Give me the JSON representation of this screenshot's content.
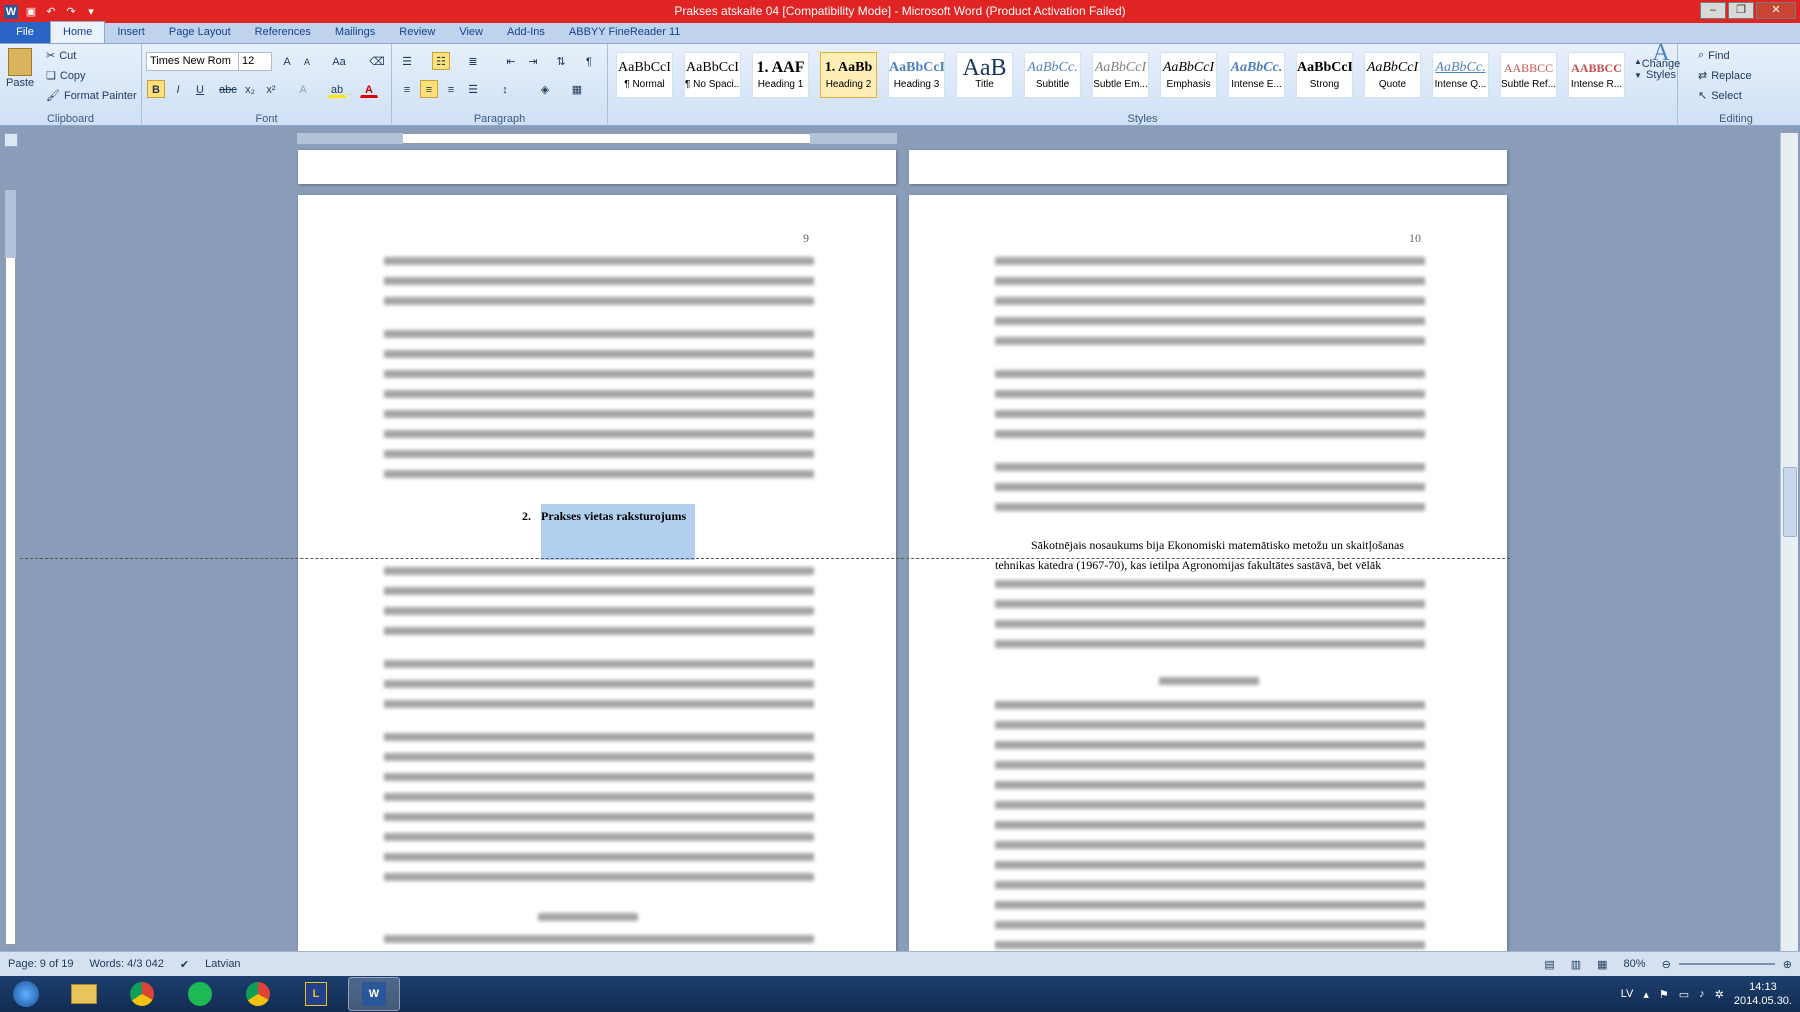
{
  "window": {
    "title": "Prakses atskaite 04 [Compatibility Mode] - Microsoft Word (Product Activation Failed)",
    "app_icon": "word-icon",
    "quick_access": [
      "save-icon",
      "undo-icon",
      "redo-icon",
      "customize-icon"
    ],
    "controls": [
      "minimize-icon",
      "restore-icon",
      "close-icon"
    ],
    "accent": "#e02424"
  },
  "tabs": [
    {
      "label": "File"
    },
    {
      "label": "Home"
    },
    {
      "label": "Insert"
    },
    {
      "label": "Page Layout"
    },
    {
      "label": "References"
    },
    {
      "label": "Mailings"
    },
    {
      "label": "Review"
    },
    {
      "label": "View"
    },
    {
      "label": "Add-Ins"
    },
    {
      "label": "ABBYY FineReader 11"
    }
  ],
  "ribbon": {
    "clipboard": {
      "label": "Clipboard",
      "paste": "Paste",
      "cut": "Cut",
      "copy": "Copy",
      "format_painter": "Format Painter"
    },
    "font": {
      "label": "Font",
      "family": "Times New Rom",
      "size": "12"
    },
    "paragraph": {
      "label": "Paragraph"
    },
    "styles": {
      "label": "Styles",
      "items": [
        {
          "preview": "AaBbCcI",
          "name": "¶ Normal"
        },
        {
          "preview": "AaBbCcI",
          "name": "¶ No Spaci..."
        },
        {
          "preview": "1. AAF",
          "name": "Heading 1"
        },
        {
          "preview": "1. AaBb",
          "name": "Heading 2"
        },
        {
          "preview": "AaBbCcI",
          "name": "Heading 3"
        },
        {
          "preview": "AaB",
          "name": "Title"
        },
        {
          "preview": "AaBbCc.",
          "name": "Subtitle"
        },
        {
          "preview": "AaBbCcI",
          "name": "Subtle Em..."
        },
        {
          "preview": "AaBbCcI",
          "name": "Emphasis"
        },
        {
          "preview": "AaBbCc.",
          "name": "Intense E..."
        },
        {
          "preview": "AaBbCcI",
          "name": "Strong"
        },
        {
          "preview": "AaBbCcI",
          "name": "Quote"
        },
        {
          "preview": "AaBbCc.",
          "name": "Intense Q..."
        },
        {
          "preview": "AABBCC",
          "name": "Subtle Ref..."
        },
        {
          "preview": "AABBCC",
          "name": "Intense R..."
        }
      ],
      "change_styles": "Change Styles"
    },
    "editing": {
      "label": "Editing",
      "find": "Find",
      "replace": "Replace",
      "select": "Select"
    }
  },
  "document": {
    "left_page_number": "9",
    "right_page_number": "10",
    "heading_number": "2.",
    "heading_text": "Prakses vietas raksturojums",
    "right_visible_line_1": "Sākotnējais nosaukums bija Ekonomiski matemātisko metožu un skaitļošanas",
    "right_visible_line_2": "tehnikas katedra (1967-70), kas ietilpa Agronomijas fakultātes sastāvā, bet vēlāk"
  },
  "status": {
    "page": "Page: 9 of 19",
    "words": "Words: 4/3 042",
    "language": "Latvian",
    "zoom": "80%"
  },
  "taskbar": {
    "apps": [
      "start-icon",
      "explorer-icon",
      "chrome-icon",
      "spotify-icon",
      "chrome-icon",
      "lingvo-icon",
      "word-icon"
    ],
    "language": "LV",
    "time": "14:13",
    "date": "2014.05.30."
  }
}
